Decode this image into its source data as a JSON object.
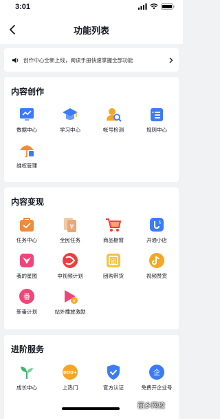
{
  "status": {
    "time": "3:01"
  },
  "nav": {
    "title": "功能列表"
  },
  "notice": {
    "text": "创作中心全新上线，阅读手册快速掌握全部功能"
  },
  "sections": [
    {
      "title": "内容创作",
      "items": [
        {
          "label": "数据中心",
          "icon": "chart-icon"
        },
        {
          "label": "学习中心",
          "icon": "graduation-cap-icon"
        },
        {
          "label": "帐号检测",
          "icon": "account-check-icon"
        },
        {
          "label": "规则中心",
          "icon": "rules-book-icon"
        },
        {
          "label": "维权管理",
          "icon": "umbrella-icon"
        }
      ]
    },
    {
      "title": "内容变现",
      "items": [
        {
          "label": "任务中心",
          "icon": "task-bag-icon"
        },
        {
          "label": "全民任务",
          "icon": "coin-cards-icon"
        },
        {
          "label": "商品橱窗",
          "icon": "shopping-cart-icon"
        },
        {
          "label": "开通小店",
          "icon": "shop-icon"
        },
        {
          "label": "我的星图",
          "icon": "star-map-icon"
        },
        {
          "label": "中视频计划",
          "icon": "play-circle-icon"
        },
        {
          "label": "团购带货",
          "icon": "group-buy-icon"
        },
        {
          "label": "视频赞赏",
          "icon": "tiktok-reward-icon"
        },
        {
          "label": "新番计划",
          "icon": "anime-icon"
        },
        {
          "label": "站外播放激励",
          "icon": "play-reward-icon"
        }
      ]
    },
    {
      "title": "进阶服务",
      "items": [
        {
          "label": "成长中心",
          "icon": "sprout-icon"
        },
        {
          "label": "上热门",
          "icon": "dou-plus-icon"
        },
        {
          "label": "官方认证",
          "icon": "verified-shield-icon"
        },
        {
          "label": "免费开企业号",
          "icon": "enterprise-icon"
        }
      ]
    }
  ],
  "watermark": {
    "text": "丽乡网校"
  },
  "colors": {
    "orange": "#f6a623",
    "blue": "#3b7cf6",
    "pink": "#f0457a",
    "red": "#f03c3c",
    "green": "#3cb371"
  }
}
